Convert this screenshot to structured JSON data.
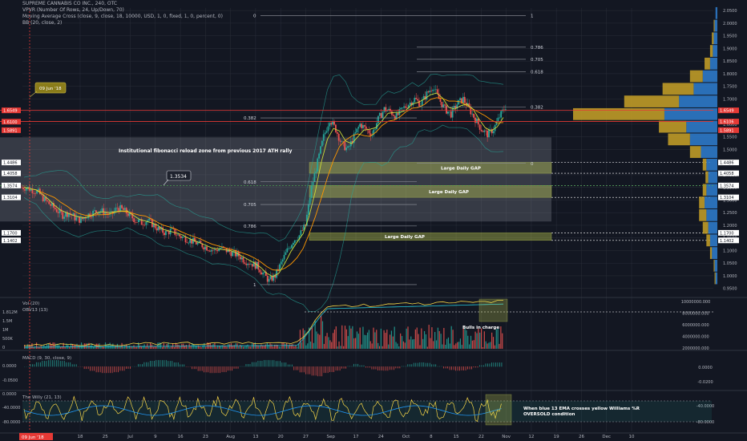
{
  "header": {
    "title": "SUPREME CANNABIS CO INC., 240, OTC",
    "line2": "VPVR (Number Of Rows, 24, Up/Down, 70)",
    "line3": "Moving Average Cross (close, 9, close, 18, 10000, USD, 1, 0, fixed, 1, 0, percent, 0)",
    "line4": "BB (20, close, 2)"
  },
  "colors": {
    "bg": "#131722",
    "up": "#26a69a",
    "down": "#ef5350",
    "yellow": "#f5d547",
    "blue": "#2196f3",
    "red": "#e53935",
    "vpUp": "#c9a227",
    "vpDown": "#2f7fd1",
    "gap": "#d4e157",
    "grid": "#2a2e39",
    "text": "#b2b5be"
  },
  "annotations": {
    "callout_date": "09 Jun '18",
    "callout_price": "1.3534",
    "zone_label": "Institutional fibonacci reload zone from previous 2017 ATH rally",
    "gap1": "Large Daily GAP",
    "gap2": "Large Daily GAP",
    "gap3": "Large Daily GAP",
    "bulls": "Bulls in charge",
    "willy_note_1": "When blue 13 EMA crosses yellow Williams %R",
    "willy_note_2": "OVERSOLD condition"
  },
  "fib_right": [
    {
      "ratio": "1",
      "price": 2.03
    },
    {
      "ratio": "0.786",
      "price": 1.905
    },
    {
      "ratio": "0.705",
      "price": 1.857
    },
    {
      "ratio": "0.618",
      "price": 1.807
    },
    {
      "ratio": "0.382",
      "price": 1.668
    },
    {
      "ratio": "0",
      "price": 1.445
    }
  ],
  "fib_left": [
    {
      "ratio": "0",
      "price": 2.03
    },
    {
      "ratio": "0.382",
      "price": 1.625
    },
    {
      "ratio": "0.618",
      "price": 1.372
    },
    {
      "ratio": "0.705",
      "price": 1.282
    },
    {
      "ratio": "0.786",
      "price": 1.197
    },
    {
      "ratio": "1",
      "price": 0.965
    }
  ],
  "price_axis": {
    "ticks": [
      "2.0500",
      "2.0000",
      "1.9500",
      "1.9000",
      "1.8500",
      "1.8000",
      "1.7500",
      "1.7000",
      "1.6500",
      "1.6000",
      "1.5500",
      "1.5000",
      "1.4500",
      "1.4000",
      "1.3500",
      "1.3000",
      "1.2500",
      "1.2000",
      "1.1500",
      "1.1000",
      "1.0500",
      "1.0000",
      "0.9500"
    ],
    "tags": [
      {
        "label": "1.4486",
        "price": 1.4486
      },
      {
        "label": "1.4058",
        "price": 1.4058
      },
      {
        "label": "1.3574",
        "price": 1.3574
      },
      {
        "label": "1.3104",
        "price": 1.3104
      },
      {
        "label": "1.1700",
        "price": 1.17
      },
      {
        "label": "1.1402",
        "price": 1.1402
      }
    ],
    "red_tags": [
      {
        "label": "1.6549",
        "price": 1.6549
      },
      {
        "label": "1.6106",
        "price": 1.6106
      },
      {
        "label": "1.5891",
        "price": 1.5891
      }
    ],
    "left_tags": [
      {
        "label": "1.6549",
        "price": 1.6549
      },
      {
        "label": "1.6100",
        "price": 1.61
      },
      {
        "label": "1.5891",
        "price": 1.5891
      },
      {
        "label": "1.4486",
        "price": 1.4486
      },
      {
        "label": "1.4058",
        "price": 1.4058
      },
      {
        "label": "1.3574",
        "price": 1.3574
      },
      {
        "label": "1.3104",
        "price": 1.3104
      },
      {
        "label": "1.1700",
        "price": 1.17
      },
      {
        "label": "1.1402",
        "price": 1.1402
      }
    ]
  },
  "volume_pane": {
    "label": "Vol (20)",
    "obv_label": "OBV13 (13)",
    "left_ticks": [
      "1.812M",
      "1.5M",
      "1M",
      "500K",
      "0"
    ],
    "right_ticks": [
      "10000000.000",
      "8000000.000",
      "6000000.000",
      "4000000.000",
      "2000000.000"
    ]
  },
  "macd_pane": {
    "label": "MACD (9, 30, close, 9)",
    "left_ticks": [
      "0.0000",
      "-0.0500"
    ],
    "right_ticks": [
      "0.0000",
      "-0.0200"
    ]
  },
  "willy_pane": {
    "label": "The Willy (21, 13)",
    "left_ticks": [
      "0.0000",
      "-40.0000",
      "-80.0000"
    ],
    "right_ticks": [
      "-40.0000",
      "-80.0000"
    ]
  },
  "time_axis": [
    "18",
    "25",
    "Jul",
    "9",
    "16",
    "23",
    "Aug",
    "13",
    "20",
    "27",
    "Sep",
    "17",
    "24",
    "Oct",
    "8",
    "15",
    "22",
    "Nov",
    "12",
    "19",
    "26",
    "Dec",
    "10"
  ],
  "time_axis_marker": "09 Jun '18",
  "chart_data": {
    "type": "candlestick",
    "title": "SUPREME CANNABIS CO INC., 240, OTC",
    "ylim": [
      0.93,
      2.06
    ],
    "series_price": [
      1.35,
      1.34,
      1.33,
      1.3,
      1.28,
      1.26,
      1.24,
      1.25,
      1.23,
      1.22,
      1.24,
      1.25,
      1.26,
      1.25,
      1.24,
      1.27,
      1.26,
      1.24,
      1.22,
      1.21,
      1.22,
      1.2,
      1.18,
      1.17,
      1.18,
      1.16,
      1.15,
      1.14,
      1.13,
      1.12,
      1.11,
      1.1,
      1.11,
      1.1,
      1.09,
      1.08,
      1.06,
      1.05,
      1.04,
      1.01,
      0.98,
      1.0,
      1.05,
      1.1,
      1.14,
      1.16,
      1.2,
      1.35,
      1.45,
      1.55,
      1.62,
      1.58,
      1.52,
      1.5,
      1.55,
      1.6,
      1.58,
      1.56,
      1.62,
      1.66,
      1.65,
      1.63,
      1.66,
      1.68,
      1.7,
      1.68,
      1.72,
      1.75,
      1.7,
      1.66,
      1.64,
      1.68,
      1.7,
      1.66,
      1.62,
      1.58,
      1.56,
      1.58,
      1.63,
      1.67
    ],
    "vp_rows": [
      {
        "price": 2.04,
        "up": 0,
        "down": 2
      },
      {
        "price": 1.99,
        "up": 1,
        "down": 3
      },
      {
        "price": 1.94,
        "up": 2,
        "down": 4
      },
      {
        "price": 1.89,
        "up": 3,
        "down": 5
      },
      {
        "price": 1.84,
        "up": 6,
        "down": 8
      },
      {
        "price": 1.79,
        "up": 14,
        "down": 16
      },
      {
        "price": 1.74,
        "up": 34,
        "down": 26
      },
      {
        "price": 1.69,
        "up": 60,
        "down": 42
      },
      {
        "price": 1.64,
        "up": 100,
        "down": 58
      },
      {
        "price": 1.59,
        "up": 30,
        "down": 34
      },
      {
        "price": 1.54,
        "up": 24,
        "down": 30
      },
      {
        "price": 1.49,
        "up": 12,
        "down": 18
      },
      {
        "price": 1.44,
        "up": 4,
        "down": 12
      },
      {
        "price": 1.39,
        "up": 3,
        "down": 10
      },
      {
        "price": 1.34,
        "up": 4,
        "down": 12
      },
      {
        "price": 1.29,
        "up": 6,
        "down": 14
      },
      {
        "price": 1.24,
        "up": 8,
        "down": 12
      },
      {
        "price": 1.19,
        "up": 6,
        "down": 10
      },
      {
        "price": 1.14,
        "up": 4,
        "down": 8
      },
      {
        "price": 1.09,
        "up": 2,
        "down": 6
      },
      {
        "price": 1.04,
        "up": 1,
        "down": 3
      },
      {
        "price": 0.99,
        "up": 1,
        "down": 2
      }
    ]
  }
}
